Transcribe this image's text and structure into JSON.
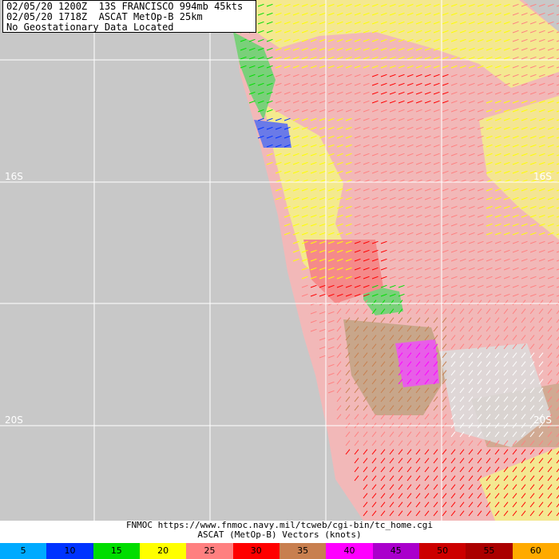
{
  "header": {
    "lines": [
      "02/05/20 1200Z  13S FRANCISCO 994mb 45kts",
      "02/05/20 1718Z  ASCAT MetOp-B 25km",
      "No Geostationary Data Located"
    ]
  },
  "map": {
    "background_color": "#c8c8c8",
    "grid_color": "#ffffff",
    "latitude_labels": [
      "16S",
      "20S"
    ],
    "latitude_labels_right": [
      "16S",
      "20S"
    ]
  },
  "footer": {
    "source_line": "FNMOC https://www.fnmoc.navy.mil/tcweb/cgi-bin/tc_home.cgi",
    "product_line": "ASCAT (MetOp-B) Vectors (knots)"
  },
  "wind_scale": [
    {
      "label": "5",
      "color": "#00aaff"
    },
    {
      "label": "10",
      "color": "#0033ff"
    },
    {
      "label": "15",
      "color": "#00dd00"
    },
    {
      "label": "20",
      "color": "#ffff00"
    },
    {
      "label": "25",
      "color": "#ff8080"
    },
    {
      "label": "30",
      "color": "#ff0000"
    },
    {
      "label": "35",
      "color": "#c87f4f"
    },
    {
      "label": "40",
      "color": "#ff00ff"
    },
    {
      "label": "45",
      "color": "#aa00cc"
    },
    {
      "label": "50",
      "color": "#cc0000"
    },
    {
      "label": "55",
      "color": "#aa0000"
    },
    {
      "label": "60",
      "color": "#ffaa00"
    }
  ]
}
